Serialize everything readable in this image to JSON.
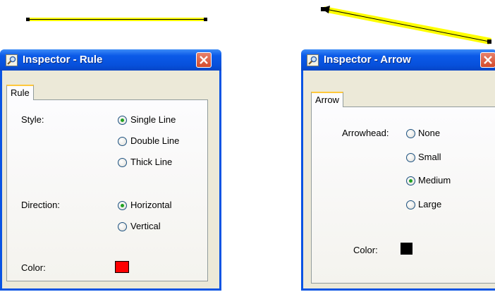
{
  "rule_window": {
    "title": "Inspector - Rule",
    "tab": "Rule",
    "style_label": "Style:",
    "style_options": [
      "Single Line",
      "Double Line",
      "Thick Line"
    ],
    "style_selected": "Single Line",
    "direction_label": "Direction:",
    "direction_options": [
      "Horizontal",
      "Vertical"
    ],
    "direction_selected": "Horizontal",
    "color_label": "Color:",
    "color_value": "#ff0000"
  },
  "arrow_window": {
    "title": "Inspector - Arrow",
    "tab": "Arrow",
    "arrowhead_label": "Arrowhead:",
    "arrowhead_options": [
      "None",
      "Small",
      "Medium",
      "Large"
    ],
    "arrowhead_selected": "Medium",
    "color_label": "Color:",
    "color_value": "#000000"
  },
  "icons": {
    "title_icon": "magnifier-icon",
    "close_icon": "close-icon"
  },
  "colors": {
    "selection_highlight": "#ffff00",
    "titlebar_blue": "#0b5ae8",
    "close_red": "#d34a2b"
  }
}
